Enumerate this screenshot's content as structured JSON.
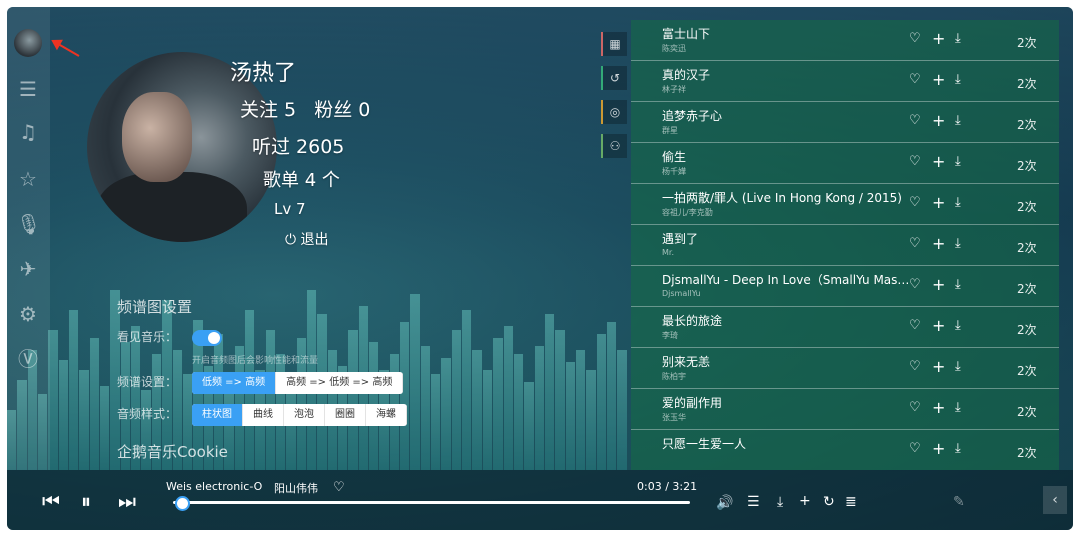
{
  "profile": {
    "name": "汤热了",
    "follow_fans": "关注 5   粉丝 0",
    "listened": "听过 2605",
    "playlists": "歌单 4 个",
    "level": "Lv 7",
    "logout": "退出"
  },
  "settings": {
    "title": "频谱图设置",
    "see_music_label": "看见音乐：",
    "see_music_on": true,
    "hint": "开启音频图后会影响性能和流量",
    "freq_label": "频谱设置：",
    "freq_options": [
      "低频 => 高频",
      "高频 => 低频 => 高频"
    ],
    "style_label": "音频样式：",
    "style_options": [
      "柱状图",
      "曲线",
      "泡泡",
      "圈圈",
      "海螺"
    ],
    "cookie_title": "企鹅音乐Cookie"
  },
  "playlist": [
    {
      "title": "富士山下",
      "artist": "陈奕迅",
      "count": "2次"
    },
    {
      "title": "真的汉子",
      "artist": "林子祥",
      "count": "2次"
    },
    {
      "title": "追梦赤子心",
      "artist": "群星",
      "count": "2次"
    },
    {
      "title": "偷生",
      "artist": "杨千嬅",
      "count": "2次"
    },
    {
      "title": "一拍两散/罪人 (Live In Hong Kong / 2015)",
      "artist": "容祖儿/李克勤",
      "count": "2次"
    },
    {
      "title": "遇到了",
      "artist": "Mr.",
      "count": "2次"
    },
    {
      "title": "DjsmallYu - Deep In Love（SmallYu Mashup）",
      "artist": "DjsmallYu",
      "count": "2次"
    },
    {
      "title": "最长的旅途",
      "artist": "李琦",
      "count": "2次"
    },
    {
      "title": "别来无恙",
      "artist": "陈柏宇",
      "count": "2次"
    },
    {
      "title": "爱的副作用",
      "artist": "张玉华",
      "count": "2次"
    },
    {
      "title": "只愿一生爱一人",
      "artist": "",
      "count": "2次"
    }
  ],
  "player": {
    "song": "Weis electronic-O",
    "singer": "阳山伟伟",
    "time": "0:03 / 3:21",
    "progress": 0.015
  },
  "icons": {
    "sidebar": [
      "search-list-icon",
      "playlist-icon",
      "star-icon",
      "mic-icon",
      "plane-icon",
      "gear-icon",
      "v-logo-icon"
    ],
    "mid_tabs": [
      "calendar-icon",
      "history-icon",
      "radar-icon",
      "user-icon"
    ]
  },
  "colors": {
    "accent": "#3aa0f4",
    "playlist_bg": "#146e46"
  }
}
